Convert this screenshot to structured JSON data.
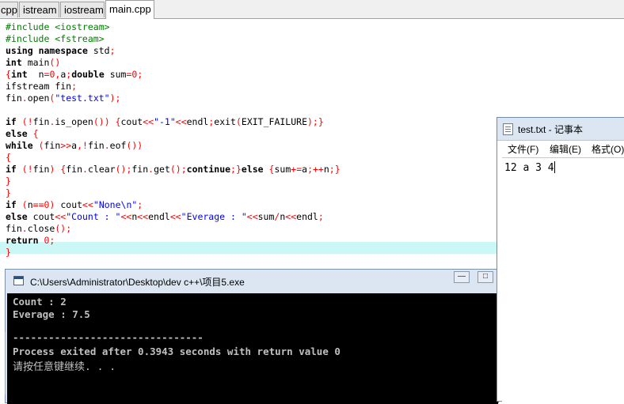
{
  "editor": {
    "tabs": [
      {
        "label": "cpp",
        "active": false
      },
      {
        "label": "istream",
        "active": false
      },
      {
        "label": "iostream",
        "active": false
      },
      {
        "label": "main.cpp",
        "active": true
      }
    ],
    "highlighted_line_index": 18,
    "code_lines": [
      "#include <iostream>",
      "#include <fstream>",
      "using namespace std;",
      "int main()",
      "{int  n=0,a;double sum=0;",
      "ifstream fin;",
      "fin.open(\"test.txt\");",
      "",
      "if (!fin.is_open()) {cout<<\"-1\"<<endl;exit(EXIT_FAILURE);}",
      "else {",
      "while (fin>>a,!fin.eof())",
      "{",
      "if (!fin) {fin.clear();fin.get();continue;}else {sum+=a;++n;}",
      "}",
      "}",
      "if (n==0) cout<<\"None\\n\";",
      "else cout<<\"Count : \"<<n<<endl<<\"Everage : \"<<sum/n<<endl;",
      "fin.close();",
      "return 0;",
      "}"
    ]
  },
  "notepad": {
    "title": "test.txt - 记事本",
    "menu": [
      "文件(F)",
      "编辑(E)",
      "格式(O)"
    ],
    "content": "12 a 3 4"
  },
  "console": {
    "title": "C:\\Users\\Administrator\\Desktop\\dev c++\\项目5.exe",
    "lines": [
      "Count : 2",
      "Everage : 7.5",
      "",
      "--------------------------------",
      "Process exited after 0.3943 seconds with return value 0",
      "请按任意键继续. . ."
    ],
    "minimize_label": "—",
    "maximize_label": "□"
  },
  "colors": {
    "preprocessor": "#008000",
    "string": "#0000ff",
    "number": "#ff0000",
    "highlight_line": "#ccf7f7"
  }
}
